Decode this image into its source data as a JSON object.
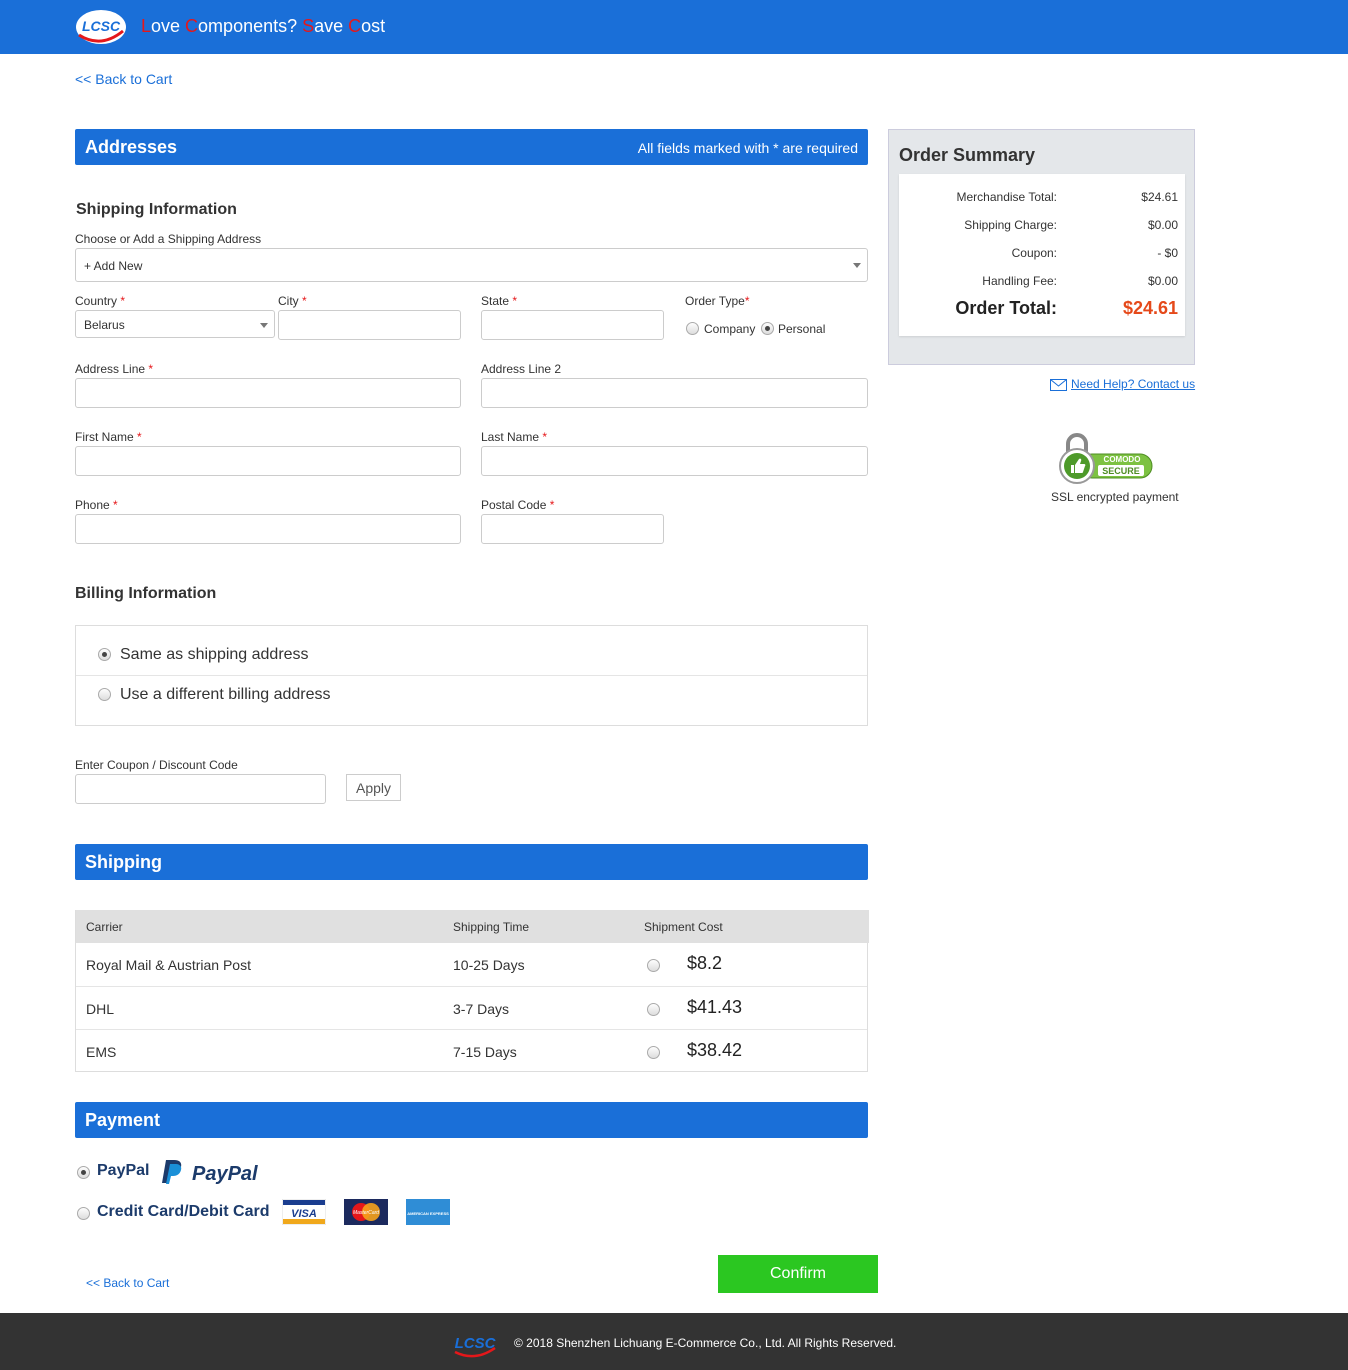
{
  "header": {
    "logo_text": "LCSC",
    "slogan": [
      {
        "t": "L",
        "red": true
      },
      {
        "t": "ove ",
        "red": false
      },
      {
        "t": "C",
        "red": true
      },
      {
        "t": "omponents? ",
        "red": false
      },
      {
        "t": "S",
        "red": true
      },
      {
        "t": "ave ",
        "red": false
      },
      {
        "t": "C",
        "red": true
      },
      {
        "t": "ost",
        "red": false
      }
    ]
  },
  "back_to_cart": "<< Back to Cart",
  "addresses": {
    "title": "Addresses",
    "required_note": "All fields marked with * are required",
    "shipping_title": "Shipping Information",
    "choose_label": "Choose or Add a Shipping Address",
    "choose_value": "+ Add New",
    "country_label": "Country",
    "country_value": "Belarus",
    "city_label": "City",
    "state_label": "State",
    "order_type_label": "Order Type",
    "order_type_company": "Company",
    "order_type_personal": "Personal",
    "address_line_label": "Address Line",
    "address_line2_label": "Address Line 2",
    "first_name_label": "First Name",
    "last_name_label": "Last Name",
    "phone_label": "Phone",
    "postal_code_label": "Postal Code",
    "required_star": "*"
  },
  "billing": {
    "title": "Billing Information",
    "same_label": "Same as shipping address",
    "different_label": "Use a different billing address"
  },
  "coupon": {
    "label": "Enter Coupon / Discount Code",
    "apply_label": "Apply"
  },
  "shipping": {
    "title": "Shipping",
    "headers": [
      "Carrier",
      "Shipping Time",
      "Shipment Cost"
    ],
    "rows": [
      {
        "carrier": "Royal Mail & Austrian Post",
        "time": "10-25 Days",
        "cost": "$8.2"
      },
      {
        "carrier": "DHL",
        "time": "3-7 Days",
        "cost": "$41.43"
      },
      {
        "carrier": "EMS",
        "time": "7-15 Days",
        "cost": "$38.42"
      }
    ]
  },
  "payment": {
    "title": "Payment",
    "paypal_label": "PayPal",
    "paypal_logo_text": "PayPal",
    "card_label": "Credit Card/Debit Card",
    "card_logos": [
      "VISA",
      "MasterCard",
      "AMERICAN EXPRESS"
    ]
  },
  "confirm_label": "Confirm",
  "back_to_cart_bottom": "<< Back to Cart",
  "summary": {
    "title": "Order Summary",
    "rows": [
      {
        "label": "Merchandise Total:",
        "value": "$24.61"
      },
      {
        "label": "Shipping Charge:",
        "value": "$0.00"
      },
      {
        "label": "Coupon:",
        "value": "- $0"
      },
      {
        "label": "Handling Fee:",
        "value": "$0.00"
      }
    ],
    "total_label": "Order Total:",
    "total_value": "$24.61"
  },
  "help_text": "Need Help? Contact us",
  "ssl": {
    "badge_top": "COMODO",
    "badge_bottom": "SECURE",
    "caption": "SSL encrypted payment"
  },
  "footer": {
    "logo_text": "LCSC",
    "copyright": "© 2018 Shenzhen Lichuang E-Commerce Co., Ltd. All Rights Reserved."
  },
  "colors": {
    "brand_blue": "#1a6fd8",
    "accent_red": "#e5171a",
    "confirm_green": "#2bc721",
    "total_orange": "#e5491a"
  }
}
